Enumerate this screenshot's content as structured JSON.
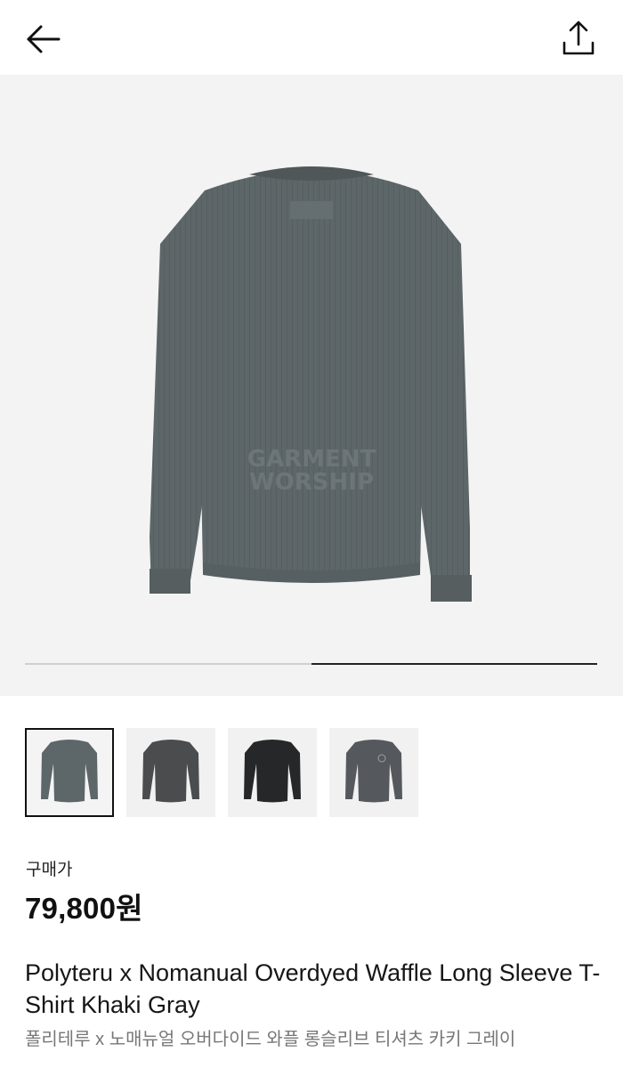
{
  "header": {
    "back_icon": "arrow-left-icon",
    "share_icon": "share-upload-icon"
  },
  "gallery": {
    "main_image": "gray waffle long sleeve t-shirt back view",
    "progress": 0.5,
    "thumbnails": [
      {
        "name": "gray-shirt-back",
        "selected": true
      },
      {
        "name": "charcoal-shirt-front",
        "selected": false
      },
      {
        "name": "black-shirt-front",
        "selected": false
      },
      {
        "name": "gray-shirt-front-logo",
        "selected": false
      }
    ]
  },
  "product": {
    "price_label": "구매가",
    "price": "79,800원",
    "title": "Polyteru x Nomanual Overdyed Waffle Long Sleeve T-Shirt Khaki Gray",
    "subtitle": "폴리테루 x 노매뉴얼 오버다이드 와플 롱슬리브 티셔츠 카키 그레이"
  },
  "colors": {
    "shirt_gray": "#5d6668",
    "shirt_charcoal": "#4a4c4e",
    "shirt_black": "#262728",
    "hero_bg": "#f3f3f3"
  }
}
